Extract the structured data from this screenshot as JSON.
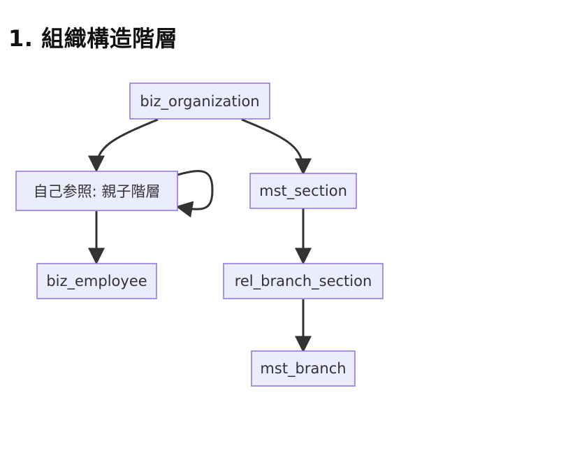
{
  "title": "1. 組織構造階層",
  "nodes": {
    "biz_organization": "biz_organization",
    "self_ref": "自己参照: 親子階層",
    "biz_employee": "biz_employee",
    "mst_section": "mst_section",
    "rel_branch_section": "rel_branch_section",
    "mst_branch": "mst_branch"
  },
  "colors": {
    "node_fill": "#ECECFF",
    "node_stroke": "#9370DB",
    "edge": "#333333",
    "text": "#333333"
  }
}
